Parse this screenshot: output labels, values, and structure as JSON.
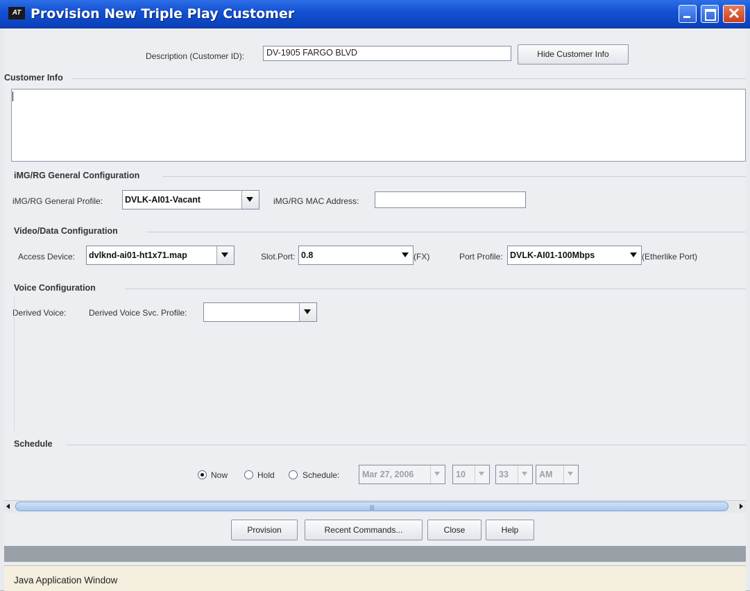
{
  "window": {
    "title": "Provision New Triple Play Customer",
    "app_icon": "AT"
  },
  "header": {
    "description_label": "Description (Customer ID):",
    "description_value": "DV-1905 FARGO BLVD",
    "hide_info_button": "Hide Customer Info"
  },
  "customer_info": {
    "title": "Customer Info",
    "text": ""
  },
  "general_config": {
    "title": "iMG/RG General Configuration",
    "profile_label": "iMG/RG General Profile:",
    "profile_value": "DVLK-AI01-Vacant",
    "mac_label": "iMG/RG MAC Address:",
    "mac_value": ""
  },
  "video_data": {
    "title": "Video/Data Configuration",
    "access_label": "Access Device:",
    "access_value": "dvlknd-ai01-ht1x71.map",
    "slot_label": "Slot.Port:",
    "slot_value": "0.8",
    "slot_suffix": "(FX)",
    "port_profile_label": "Port Profile:",
    "port_profile_value": "DVLK-AI01-100Mbps",
    "port_suffix": "(Etherlike Port)"
  },
  "voice": {
    "title": "Voice Configuration",
    "derived_label": "Derived Voice:",
    "svc_profile_label": "Derived Voice Svc. Profile:",
    "svc_profile_value": ""
  },
  "schedule": {
    "title": "Schedule",
    "options": [
      "Now",
      "Hold",
      "Schedule:"
    ],
    "selected": "Now",
    "date": "Mar 27, 2006",
    "hour": "10",
    "minute": "33",
    "ampm": "AM"
  },
  "buttons": {
    "provision": "Provision",
    "recent": "Recent Commands...",
    "close": "Close",
    "help": "Help"
  },
  "status": {
    "java_window": "Java Application Window"
  }
}
